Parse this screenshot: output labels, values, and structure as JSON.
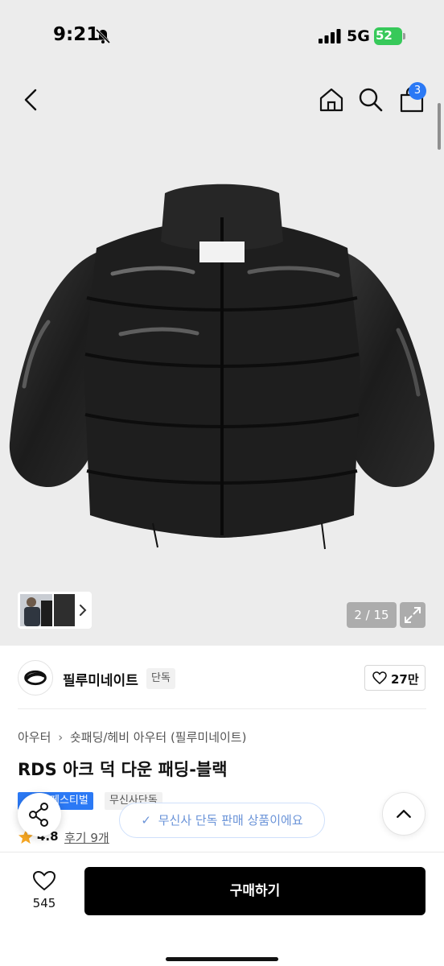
{
  "status": {
    "time": "9:21",
    "network": "5G",
    "battery": "52"
  },
  "header": {
    "cart_count": "3"
  },
  "gallery": {
    "counter": "2 / 15"
  },
  "brand": {
    "name": "필루미네이트",
    "tag": "단독",
    "likes": "27만"
  },
  "product": {
    "breadcrumb": [
      "아우터",
      "숏패딩/헤비 아우터 (필루미네이트)"
    ],
    "title": "RDS 아크 덕 다운 패딩-블랙",
    "badges": [
      "페스티벌",
      "무신사단독"
    ],
    "rating": "4.8",
    "review_label": "후기 9개"
  },
  "toast": {
    "message": "무신사 단독 판매 상품이에요"
  },
  "bottom_bar": {
    "wish_count": "545",
    "buy_label": "구매하기"
  },
  "colors": {
    "accent_blue": "#2b79f5",
    "battery_green": "#37c95a",
    "buy_button": "#000000",
    "rating_star": "#f5a623"
  }
}
